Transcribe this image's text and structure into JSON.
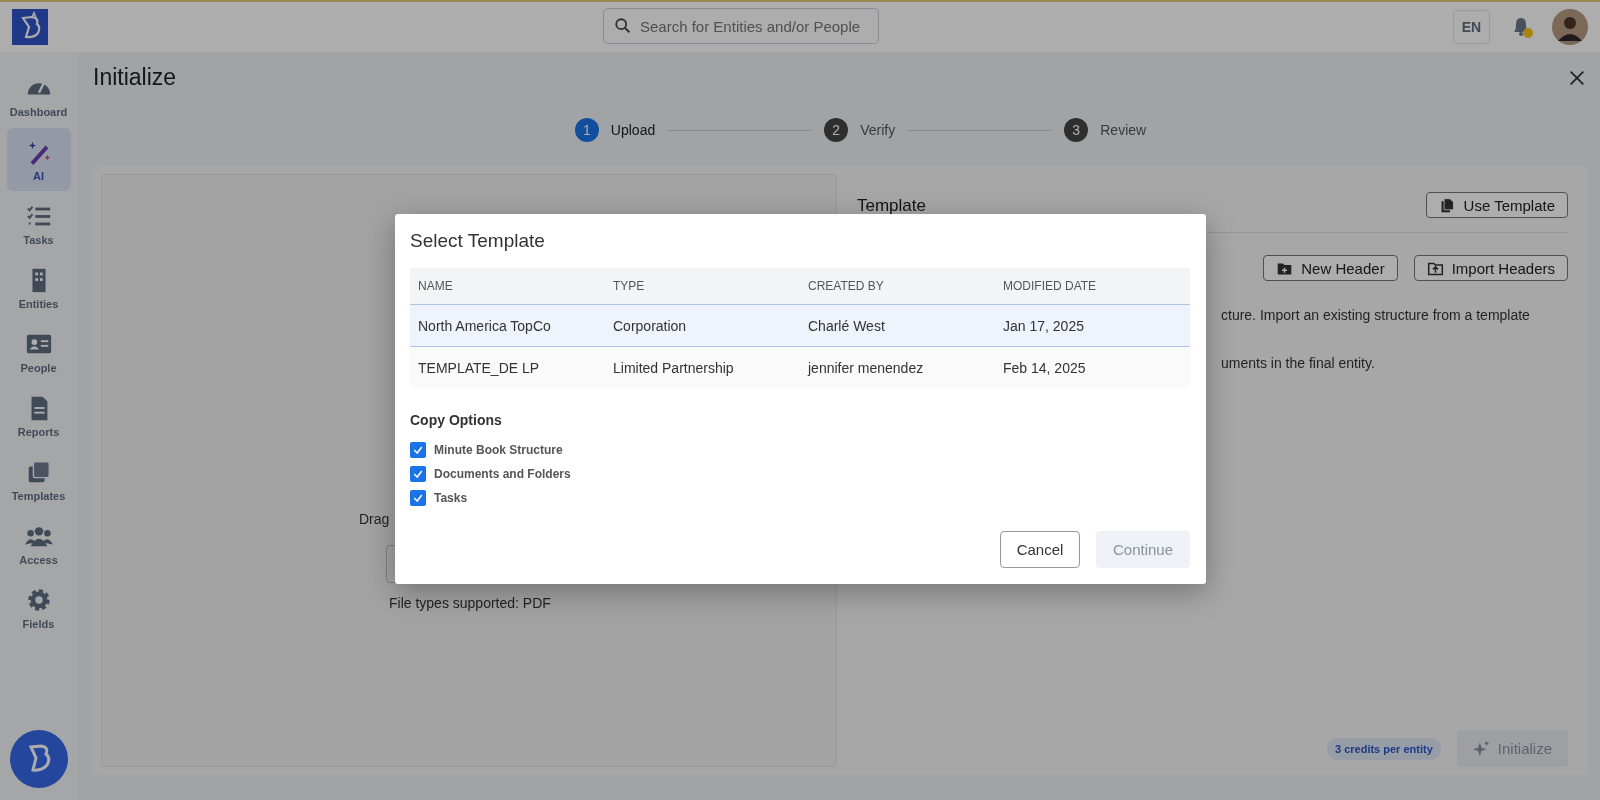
{
  "topbar": {
    "search": {
      "placeholder": "Search for Entities and/or People"
    },
    "language": "EN",
    "notifications": {
      "unread": true
    }
  },
  "sidebar": {
    "items": [
      {
        "label": "Dashboard",
        "selected": false
      },
      {
        "label": "AI",
        "selected": true
      },
      {
        "label": "Tasks",
        "selected": false
      },
      {
        "label": "Entities",
        "selected": false
      },
      {
        "label": "People",
        "selected": false
      },
      {
        "label": "Reports",
        "selected": false
      },
      {
        "label": "Templates",
        "selected": false
      },
      {
        "label": "Access",
        "selected": false
      },
      {
        "label": "Fields",
        "selected": false
      }
    ]
  },
  "page": {
    "title": "Initialize",
    "steps": [
      {
        "number": "1",
        "label": "Upload",
        "selected": true
      },
      {
        "number": "2",
        "label": "Verify",
        "selected": false
      },
      {
        "number": "3",
        "label": "Review",
        "selected": false
      }
    ]
  },
  "upload_panel": {
    "prompt": "Drag",
    "file_types": "File types supported: PDF"
  },
  "template_panel": {
    "title": "Template",
    "use_template": "Use Template",
    "new_header": "New Header",
    "import_headers": "Import Headers",
    "description": [
      "cture. Import an existing structure from a template",
      "uments in the final entity."
    ],
    "credits": "3 credits per entity",
    "initialize": {
      "label": "Initialize",
      "disabled": true
    }
  },
  "modal": {
    "title": "Select Template",
    "columns": [
      "NAME",
      "TYPE",
      "CREATED BY",
      "MODIFIED DATE"
    ],
    "rows": [
      {
        "cells": [
          "North America TopCo",
          "Corporation",
          "Charlé West",
          "Jan 17, 2025"
        ],
        "selected": true
      },
      {
        "cells": [
          "TEMPLATE_DE LP",
          "Limited Partnership",
          "jennifer menendez",
          "Feb 14, 2025"
        ],
        "selected": false
      }
    ],
    "copy_options_title": "Copy Options",
    "options": [
      {
        "label": "Minute Book Structure",
        "checked": true
      },
      {
        "label": "Documents and Folders",
        "checked": true
      },
      {
        "label": "Tasks",
        "checked": true
      }
    ],
    "cancel": "Cancel",
    "continue": {
      "label": "Continue",
      "disabled": true
    }
  }
}
